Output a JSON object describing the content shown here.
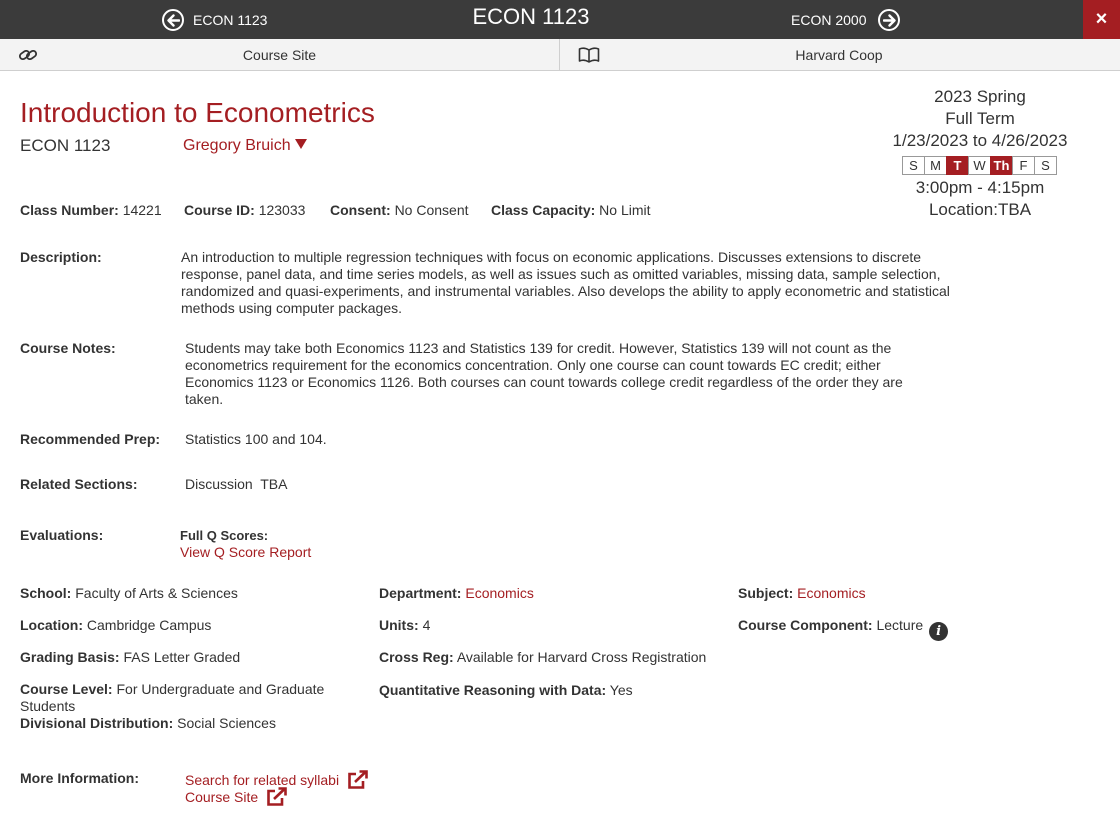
{
  "nav": {
    "prev_label": "ECON 1123",
    "title": "ECON 1123",
    "next_label": "ECON 2000",
    "close_label": "×"
  },
  "links_bar": {
    "course_site": "Course Site",
    "coop": "Harvard Coop"
  },
  "course": {
    "title": "Introduction to Econometrics",
    "code": "ECON 1123",
    "instructor": "Gregory Bruich"
  },
  "schedule": {
    "term": "2023 Spring",
    "session": "Full Term",
    "dates": "1/23/2023 to 4/26/2023",
    "days": [
      {
        "label": "S",
        "active": false
      },
      {
        "label": "M",
        "active": false
      },
      {
        "label": "T",
        "active": true
      },
      {
        "label": "W",
        "active": false
      },
      {
        "label": "Th",
        "active": true
      },
      {
        "label": "F",
        "active": false
      },
      {
        "label": "S",
        "active": false
      }
    ],
    "time": "3:00pm - 4:15pm",
    "location": "Location:TBA"
  },
  "meta": {
    "class_number_label": "Class Number:",
    "class_number": "14221",
    "course_id_label": "Course ID:",
    "course_id": "123033",
    "consent_label": "Consent:",
    "consent": "No Consent",
    "capacity_label": "Class Capacity:",
    "capacity": "No Limit"
  },
  "description": {
    "label": "Description:",
    "text": "An introduction to multiple regression techniques with focus on economic applications. Discusses extensions to discrete response, panel data, and time series models, as well as issues such as omitted variables, missing data, sample selection, randomized and quasi-experiments, and instrumental variables. Also develops the ability to apply econometric and statistical methods using computer packages."
  },
  "notes": {
    "label": "Course Notes:",
    "text": "Students may take both Economics 1123 and Statistics 139 for credit. However, Statistics 139 will not count as the econometrics requirement for the economics concentration. Only one course can count towards EC credit; either Economics 1123 or Economics 1126. Both courses can count towards college credit regardless of the order they are taken."
  },
  "prep": {
    "label": "Recommended Prep:",
    "text": "Statistics 100 and 104."
  },
  "sections": {
    "label": "Related Sections:",
    "text": "Discussion  TBA"
  },
  "evaluations": {
    "label": "Evaluations:",
    "q_label": "Full Q Scores:",
    "q_link": "View Q Score Report"
  },
  "details": {
    "school_label": "School:",
    "school": "Faculty of Arts & Sciences",
    "department_label": "Department:",
    "department": "Economics",
    "subject_label": "Subject:",
    "subject": "Economics",
    "location_label": "Location:",
    "location": "Cambridge Campus",
    "units_label": "Units:",
    "units": "4",
    "component_label": "Course Component:",
    "component": "Lecture",
    "grading_label": "Grading Basis:",
    "grading": "FAS Letter Graded",
    "crossreg_label": "Cross Reg:",
    "crossreg": "Available for Harvard Cross Registration",
    "level_label": "Course Level:",
    "level": "For Undergraduate and Graduate Students",
    "qrd_label": "Quantitative Reasoning with Data:",
    "qrd": "Yes",
    "divisional_label": "Divisional Distribution:",
    "divisional": "Social Sciences"
  },
  "more_info": {
    "label": "More Information:",
    "syllabi_link": "Search for related syllabi",
    "site_link": "Course Site"
  },
  "colors": {
    "crimson": "#a41e22",
    "topbar": "#3b3b3b"
  }
}
